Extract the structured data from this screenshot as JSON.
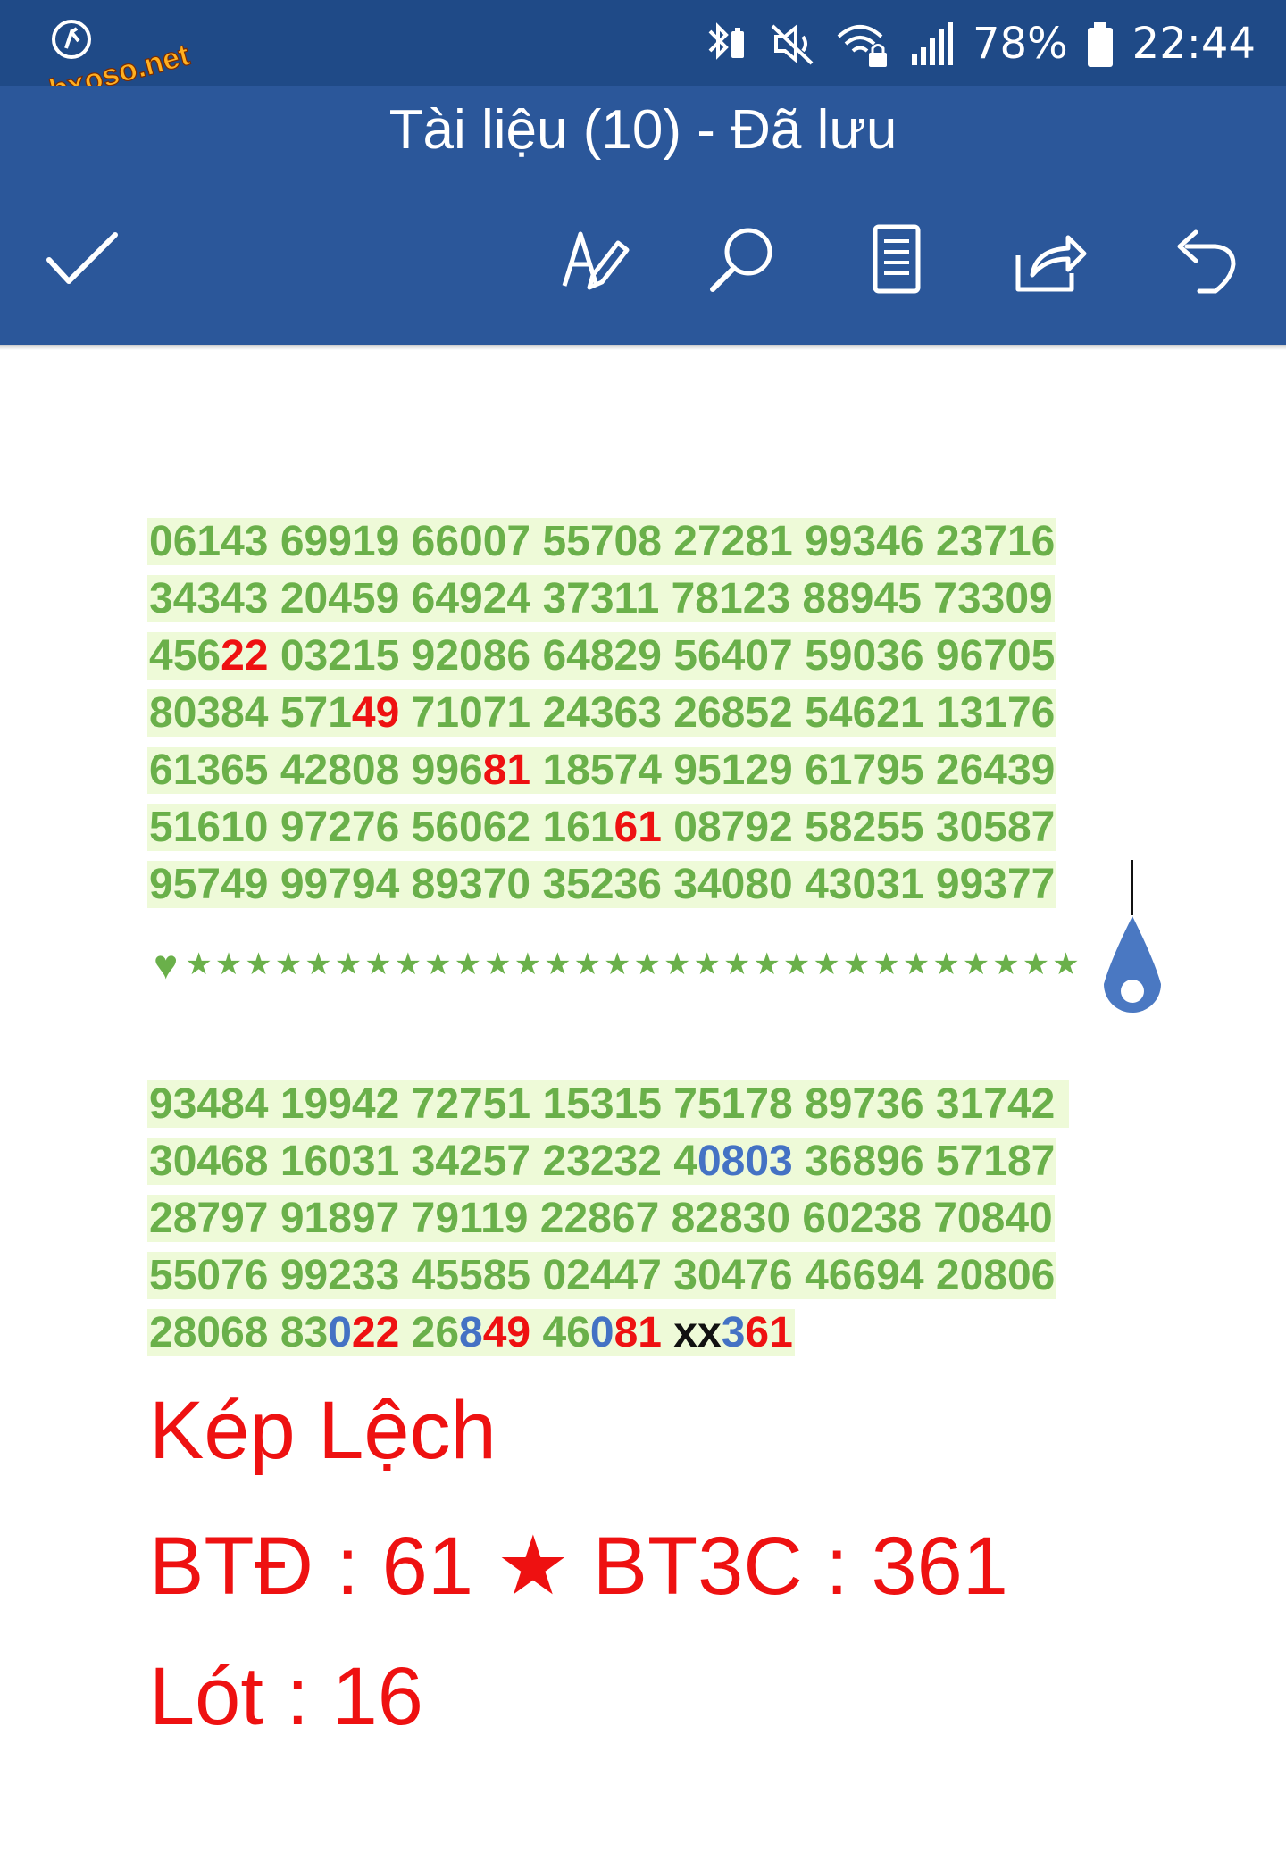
{
  "watermark": {
    "text": "webxoso.net"
  },
  "status_bar": {
    "battery_percent": "78%",
    "time": "22:44",
    "icons": [
      "bluetooth-battery-icon",
      "mute-icon",
      "wifi-lock-icon",
      "signal-icon",
      "battery-icon"
    ]
  },
  "app_bar": {
    "title": "Tài liệu (10) - Đã lưu",
    "actions": [
      "done-check-icon",
      "edit-format-icon",
      "search-icon",
      "reading-view-icon",
      "share-icon",
      "undo-icon"
    ]
  },
  "document": {
    "block1": [
      [
        {
          "t": "06143 69919 66007 55708 27281 99346 23716",
          "c": "g"
        }
      ],
      [
        {
          "t": "34343 20459 64924 37311 78123 88945 73309",
          "c": "g"
        }
      ],
      [
        {
          "t": "456",
          "c": "g"
        },
        {
          "t": "22",
          "c": "r"
        },
        {
          "t": " 03215 92086 64829 56407 59036 96705",
          "c": "g"
        }
      ],
      [
        {
          "t": "80384 571",
          "c": "g"
        },
        {
          "t": "49",
          "c": "r"
        },
        {
          "t": " 71071 24363 26852 54621 13176",
          "c": "g"
        }
      ],
      [
        {
          "t": "61365 42808 996",
          "c": "g"
        },
        {
          "t": "81",
          "c": "r"
        },
        {
          "t": " 18574 95129 61795 26439",
          "c": "g"
        }
      ],
      [
        {
          "t": "51610 97276 56062 161",
          "c": "g"
        },
        {
          "t": "61",
          "c": "r"
        },
        {
          "t": " 08792 58255 30587",
          "c": "g"
        }
      ],
      [
        {
          "t": "95749 99794 89370 35236 34080 43031 99377",
          "c": "g"
        }
      ]
    ],
    "divider": {
      "heart": "♥",
      "stars": "★★★★★★★★★★★★★★★★★★★★★★★★★★★★★★"
    },
    "block2": [
      [
        {
          "t": "93484 19942 72751 15315 75178 89736 31742 ",
          "c": "g"
        }
      ],
      [
        {
          "t": "30468 16031 34257 23232 4",
          "c": "g"
        },
        {
          "t": "0803",
          "c": "b"
        },
        {
          "t": " 36896 57187",
          "c": "g"
        }
      ],
      [
        {
          "t": "28797 91897 79119 22867 82830 60238 70840",
          "c": "g"
        }
      ],
      [
        {
          "t": "55076 99233 45585 02447 30476 46694 20806",
          "c": "g"
        }
      ],
      [
        {
          "t": "28068 83",
          "c": "g"
        },
        {
          "t": "0",
          "c": "b"
        },
        {
          "t": "22",
          "c": "r"
        },
        {
          "t": " 26",
          "c": "g"
        },
        {
          "t": "8",
          "c": "b"
        },
        {
          "t": "49",
          "c": "r"
        },
        {
          "t": " 46",
          "c": "g"
        },
        {
          "t": "0",
          "c": "b"
        },
        {
          "t": "81",
          "c": "r"
        },
        {
          "t": " ",
          "c": "g"
        },
        {
          "t": "xx",
          "c": "k"
        },
        {
          "t": "3",
          "c": "b"
        },
        {
          "t": "61",
          "c": "r"
        }
      ]
    ],
    "heading": "Kép Lệch",
    "line_btd": "BTĐ : 61 ★ BT3C : 361",
    "line_lot": "Lót : 16"
  },
  "colors": {
    "status_bar": "#1f4a87",
    "app_bar": "#2b579a",
    "number_green": "#6ab04a",
    "highlight_bg": "#eefad8",
    "accent_red": "#ee1111",
    "accent_blue": "#4472c4"
  }
}
